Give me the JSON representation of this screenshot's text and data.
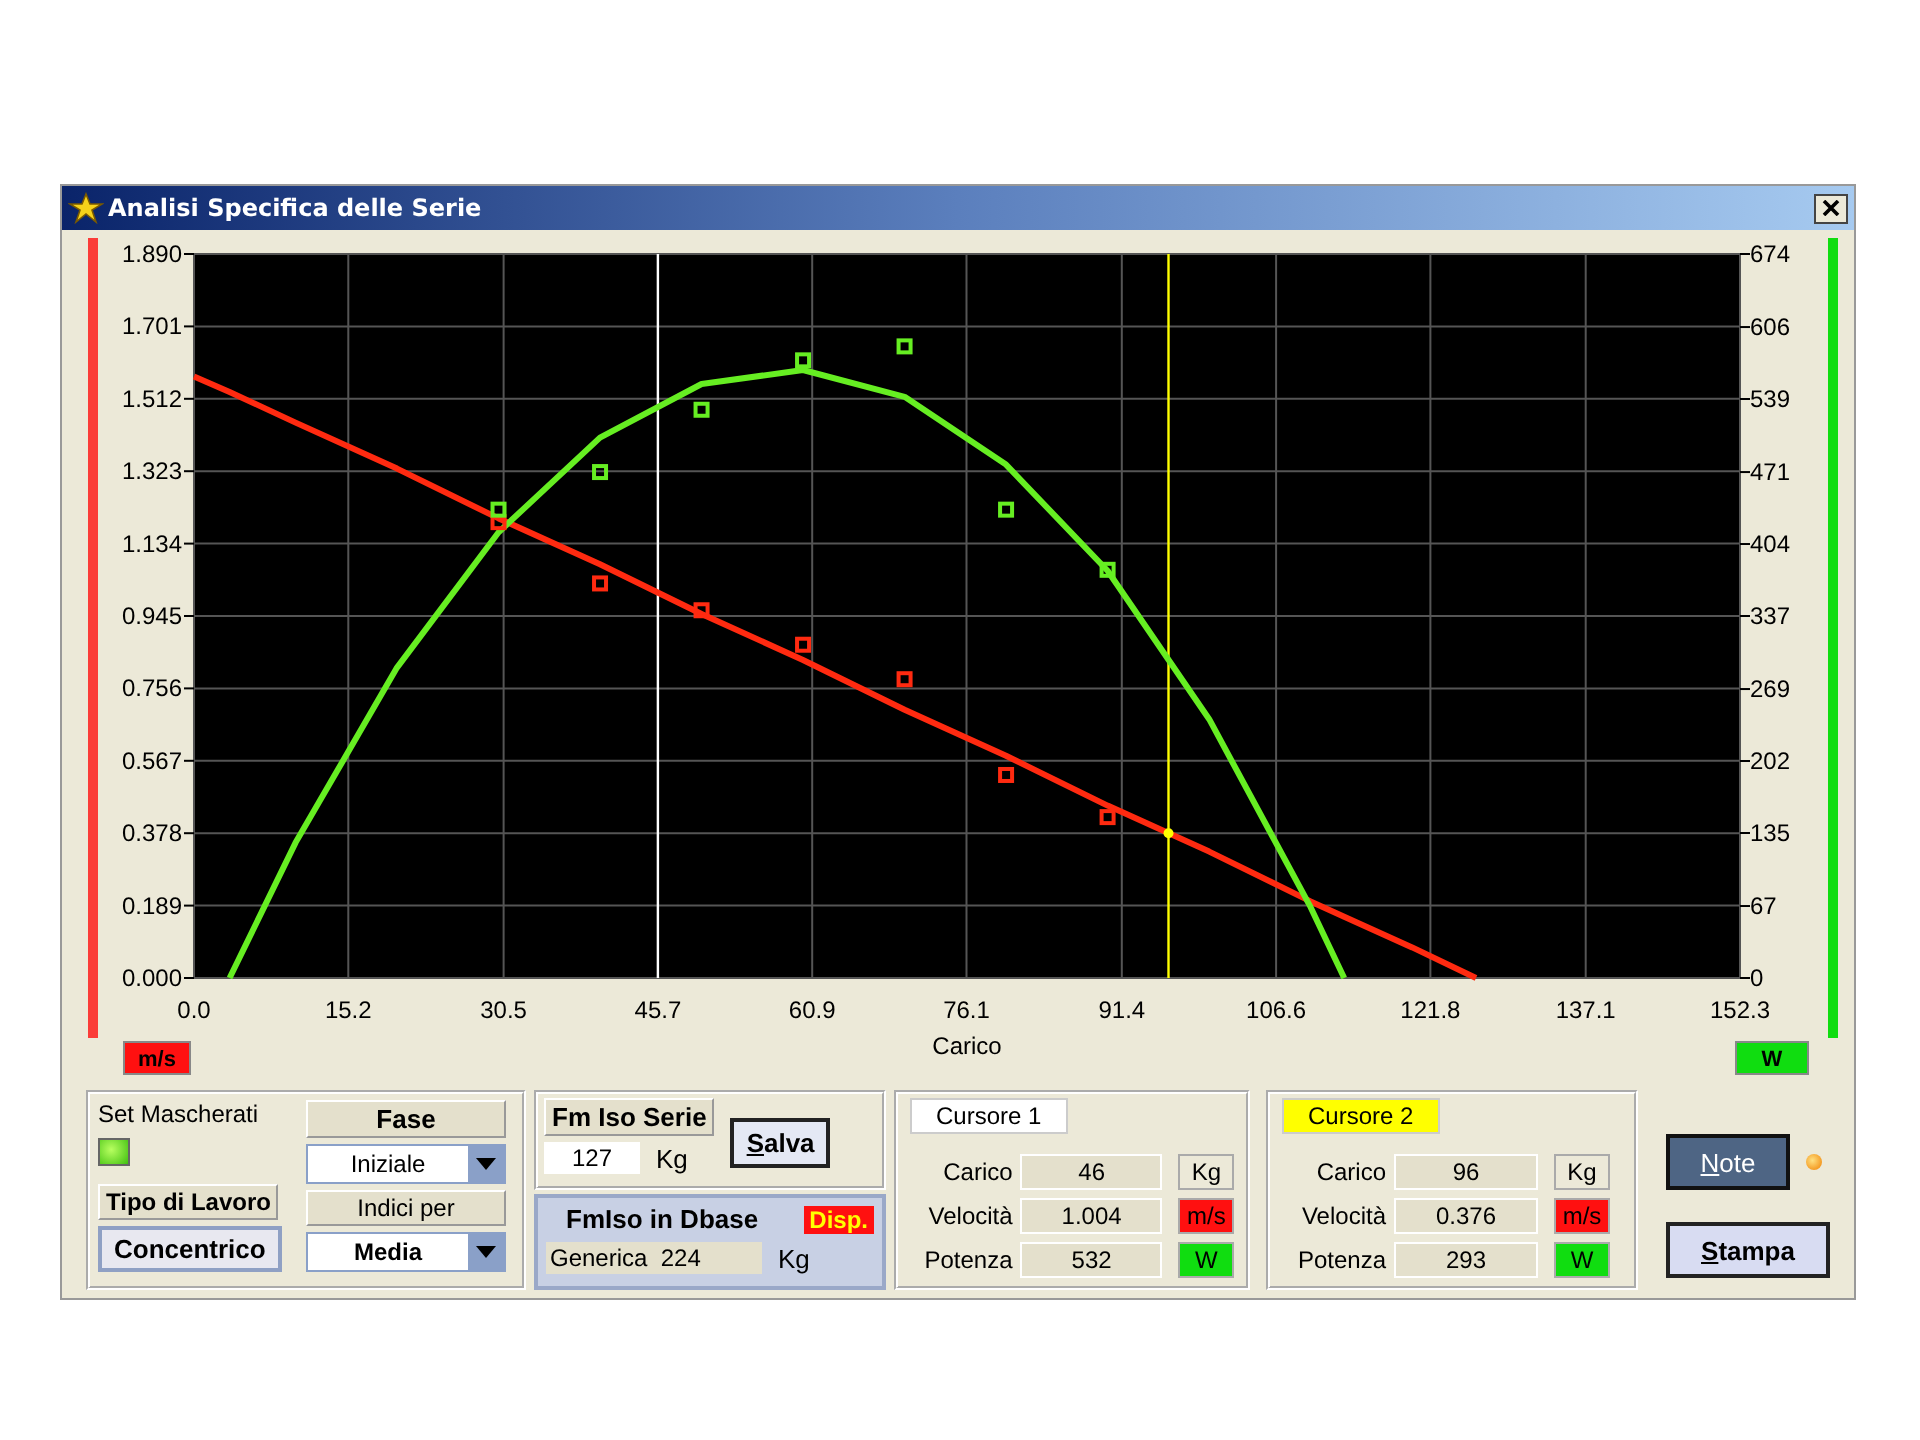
{
  "window": {
    "title": "Analisi Specifica delle Serie"
  },
  "chart": {
    "chart_data": {
      "type": "scatter",
      "xlabel": "Carico",
      "xlim": [
        0,
        152.3
      ],
      "ylim": [
        0,
        1.89
      ],
      "y2lim": [
        0,
        674
      ],
      "x": [
        0,
        3.5,
        10,
        20,
        30,
        40,
        50,
        60,
        70,
        80,
        90,
        100,
        110,
        113.3,
        120,
        126.3
      ],
      "series": [
        {
          "type": "line",
          "color": "#ff2a10",
          "values": [
            1.57,
            1.53,
            1.45,
            1.33,
            1.2,
            1.08,
            0.95,
            0.83,
            0.7,
            0.58,
            0.45,
            0.33,
            0.2,
            0.16,
            0.08,
            0
          ]
        },
        {
          "type": "line",
          "color": "#66ee22",
          "axis": "y2",
          "values": [
            null,
            0,
            126,
            289,
            415,
            503,
            553,
            566,
            541,
            478,
            379,
            241,
            66,
            0,
            null,
            null
          ]
        },
        {
          "color": "#ff2a10",
          "values": [
            null,
            null,
            null,
            null,
            1.19,
            1.03,
            0.96,
            0.87,
            0.78,
            0.53,
            0.42,
            null,
            null,
            null,
            null,
            null
          ]
        },
        {
          "color": "#66ee22",
          "axis": "y2",
          "values": [
            null,
            null,
            null,
            null,
            436,
            471,
            529,
            575,
            588,
            436,
            380,
            null,
            null,
            null,
            null,
            null
          ]
        }
      ],
      "xticks": [
        {
          "value": 0,
          "label": "0.0"
        },
        {
          "value": 15.2,
          "label": "15.2"
        },
        {
          "value": 30.5,
          "label": "30.5"
        },
        {
          "value": 45.7,
          "label": "45.7"
        },
        {
          "value": 60.9,
          "label": "60.9"
        },
        {
          "value": 76.1,
          "label": "76.1"
        },
        {
          "value": 91.4,
          "label": "91.4"
        },
        {
          "value": 106.6,
          "label": "106.6"
        },
        {
          "value": 121.8,
          "label": "121.8"
        },
        {
          "value": 137.1,
          "label": "137.1"
        },
        {
          "value": 152.3,
          "label": "152.3"
        }
      ],
      "yticks": [
        {
          "value": 0,
          "label": "0.000"
        },
        {
          "value": 0.189,
          "label": "0.189"
        },
        {
          "value": 0.378,
          "label": "0.378"
        },
        {
          "value": 0.567,
          "label": "0.567"
        },
        {
          "value": 0.756,
          "label": "0.756"
        },
        {
          "value": 0.945,
          "label": "0.945"
        },
        {
          "value": 1.134,
          "label": "1.134"
        },
        {
          "value": 1.323,
          "label": "1.323"
        },
        {
          "value": 1.512,
          "label": "1.512"
        },
        {
          "value": 1.701,
          "label": "1.701"
        },
        {
          "value": 1.89,
          "label": "1.890"
        }
      ],
      "y2ticks": [
        0,
        67,
        135,
        202,
        269,
        337,
        404,
        471,
        539,
        606,
        674
      ],
      "grid": true,
      "ref_lines": [
        {
          "axis": "x",
          "value": 45.7,
          "color": "#ffffff"
        },
        {
          "axis": "x",
          "value": 96,
          "color": "#ffff00"
        }
      ]
    },
    "left_unit": {
      "label": "m/s",
      "color": "#ff1010"
    },
    "right_unit": {
      "label": "W",
      "color": "#10dd10"
    }
  },
  "set_mascherati": {
    "label": "Set Mascherati",
    "on": true
  },
  "fase": {
    "label": "Fase",
    "value": "Iniziale"
  },
  "tipo_di_lavoro": {
    "label": "Tipo di Lavoro",
    "value": "Concentrico"
  },
  "indici_per": {
    "label": "Indici per",
    "value": "Media"
  },
  "fm_iso_serie": {
    "label": "Fm Iso Serie",
    "value": "127",
    "unit": "Kg"
  },
  "salva_button": "Salva",
  "fmiso_dbase": {
    "label": "FmIso in Dbase",
    "badge": "Disp.",
    "value": "Generica  224",
    "unit": "Kg"
  },
  "cursors": [
    {
      "title": "Cursore 1",
      "color": "#ffffff",
      "rows": [
        {
          "label": "Carico",
          "value": "46",
          "unit": "Kg",
          "color": "#ece9d8"
        },
        {
          "label": "Velocità",
          "value": "1.004",
          "unit": "m/s",
          "color": "#ff1010"
        },
        {
          "label": "Potenza",
          "value": "532",
          "unit": "W",
          "color": "#10dd10"
        }
      ]
    },
    {
      "title": "Cursore 2",
      "color": "#ffff00",
      "rows": [
        {
          "label": "Carico",
          "value": "96",
          "unit": "Kg",
          "color": "#ece9d8"
        },
        {
          "label": "Velocità",
          "value": "0.376",
          "unit": "m/s",
          "color": "#ff1010"
        },
        {
          "label": "Potenza",
          "value": "293",
          "unit": "W",
          "color": "#10dd10"
        }
      ]
    }
  ],
  "note_button": "Note",
  "note_indicator": {
    "on": true
  },
  "stampa_button": "Stampa"
}
